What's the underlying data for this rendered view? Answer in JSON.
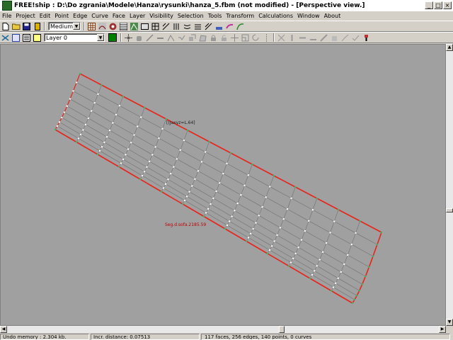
{
  "window": {
    "title": "FREE!ship   : D:\\Do zgrania\\Modele\\Hanza\\rysunki\\hanza_5.fbm (not modified) - [Perspective view.]",
    "min_glyph": "_",
    "max_glyph": "□",
    "close_glyph": "×"
  },
  "menu": [
    "File",
    "Project",
    "Edit",
    "Point",
    "Edge",
    "Curve",
    "Face",
    "Layer",
    "Visibility",
    "Selection",
    "Tools",
    "Transform",
    "Calculations",
    "Window",
    "About"
  ],
  "toolbar1": {
    "precision_value": "Medium",
    "new_icon": "new-file-icon",
    "open_icon": "open-folder-icon",
    "save_icon": "save-disk-icon"
  },
  "toolbar2": {
    "layer_value": "Layer 0",
    "layer_color": "#008000"
  },
  "viewport": {
    "annotation_a": "[(Jaxyz=L.64]",
    "annotation_b": "Seg.d.sofa.2185.59",
    "hull_edge_color": "#e8241a",
    "mesh_color": "#707070",
    "point_color": "#ffffff"
  },
  "status": {
    "undo": "Undo memory : 2.304 kb.",
    "incr": "Incr. distance: 0.07513",
    "counts": "117 faces, 256 edges, 140 points, 0 curves"
  }
}
